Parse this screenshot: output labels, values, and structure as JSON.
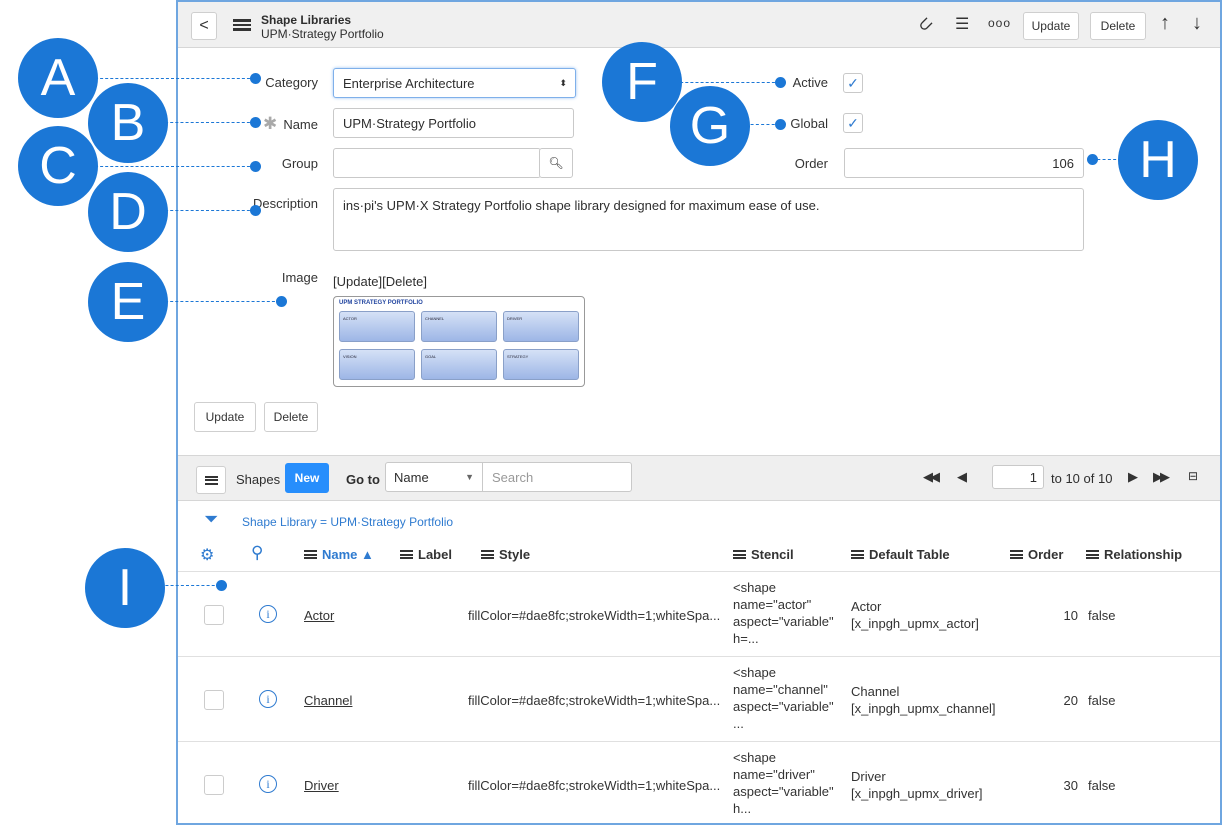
{
  "header": {
    "title": "Shape Libraries",
    "subtitle": "UPM·Strategy Portfolio",
    "update_label": "Update",
    "delete_label": "Delete"
  },
  "form": {
    "category_label": "Category",
    "category_value": "Enterprise Architecture",
    "name_label": "Name",
    "name_value": "UPM·Strategy Portfolio",
    "group_label": "Group",
    "group_value": "",
    "description_label": "Description",
    "description_value": "ins·pi's UPM·X Strategy Portfolio shape library designed for maximum ease of use.",
    "image_label": "Image",
    "image_links": "[Update][Delete]",
    "active_label": "Active",
    "global_label": "Global",
    "order_label": "Order",
    "order_value": "106",
    "update_label": "Update",
    "delete_label": "Delete"
  },
  "image_preview": {
    "title": "UPM STRATEGY PORTFOLIO",
    "tiles": [
      "ACTOR",
      "CHANNEL",
      "DRIVER",
      "VISION",
      "GOAL",
      "STRATEGY"
    ]
  },
  "list": {
    "title": "Shapes",
    "new_label": "New",
    "goto_label": "Go to",
    "goto_field": "Name",
    "search_placeholder": "Search",
    "page_value": "1",
    "page_range": "to 10 of 10",
    "filter": "Shape Library = UPM·Strategy Portfolio",
    "columns": {
      "name": "Name ▲",
      "label": "Label",
      "style": "Style",
      "stencil": "Stencil",
      "default_table": "Default Table",
      "order": "Order",
      "relationship": "Relationship"
    },
    "rows": [
      {
        "name": "Actor",
        "style": "fillColor=#dae8fc;strokeWidth=1;whiteSpa...",
        "stencil": [
          "<shape",
          "name=\"actor\"",
          "aspect=\"variable\"",
          "h=..."
        ],
        "table1": "Actor",
        "table2": "[x_inpgh_upmx_actor]",
        "order": "10",
        "relationship": "false"
      },
      {
        "name": "Channel",
        "style": "fillColor=#dae8fc;strokeWidth=1;whiteSpa...",
        "stencil": [
          "<shape",
          "name=\"channel\"",
          "aspect=\"variable\"",
          "..."
        ],
        "table1": "Channel",
        "table2": "[x_inpgh_upmx_channel]",
        "order": "20",
        "relationship": "false"
      },
      {
        "name": "Driver",
        "style": "fillColor=#dae8fc;strokeWidth=1;whiteSpa...",
        "stencil": [
          "<shape",
          "name=\"driver\"",
          "aspect=\"variable\"",
          "h..."
        ],
        "table1": "Driver",
        "table2": "[x_inpgh_upmx_driver]",
        "order": "30",
        "relationship": "false"
      }
    ]
  },
  "annotations": [
    "A",
    "B",
    "C",
    "D",
    "E",
    "F",
    "G",
    "H",
    "I"
  ],
  "colors": {
    "accent": "#1b77d6",
    "link": "#2f7bd0",
    "new_button": "#278efc"
  }
}
